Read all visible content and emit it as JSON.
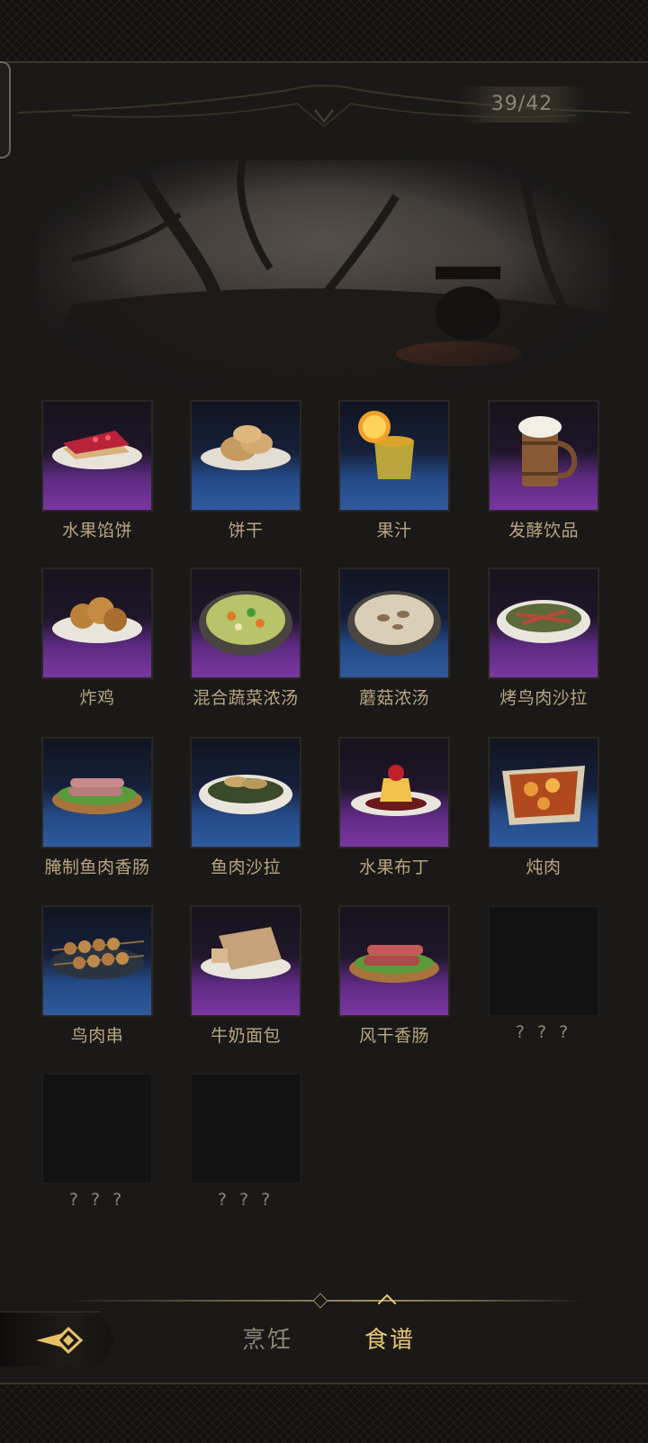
{
  "header": {
    "counter": "39/42"
  },
  "recipes": [
    {
      "label": "水果馅饼",
      "rarity": "purple",
      "icon": "fruit-pie-icon"
    },
    {
      "label": "饼干",
      "rarity": "blue",
      "icon": "biscuits-icon"
    },
    {
      "label": "果汁",
      "rarity": "blue",
      "icon": "juice-icon"
    },
    {
      "label": "发酵饮品",
      "rarity": "purple",
      "icon": "ale-mug-icon"
    },
    {
      "label": "炸鸡",
      "rarity": "purple",
      "icon": "fried-chicken-icon"
    },
    {
      "label": "混合蔬菜浓汤",
      "rarity": "purple",
      "icon": "vegetable-soup-icon"
    },
    {
      "label": "蘑菇浓汤",
      "rarity": "blue",
      "icon": "mushroom-soup-icon"
    },
    {
      "label": "烤鸟肉沙拉",
      "rarity": "purple",
      "icon": "bird-salad-icon"
    },
    {
      "label": "腌制鱼肉香肠",
      "rarity": "blue",
      "icon": "fish-sausage-icon"
    },
    {
      "label": "鱼肉沙拉",
      "rarity": "blue",
      "icon": "fish-salad-icon"
    },
    {
      "label": "水果布丁",
      "rarity": "purple",
      "icon": "pudding-icon"
    },
    {
      "label": "炖肉",
      "rarity": "blue",
      "icon": "stew-icon"
    },
    {
      "label": "鸟肉串",
      "rarity": "blue",
      "icon": "bird-skewer-icon"
    },
    {
      "label": "牛奶面包",
      "rarity": "purple",
      "icon": "milk-bread-icon"
    },
    {
      "label": "风干香肠",
      "rarity": "purple",
      "icon": "dried-sausage-icon"
    },
    {
      "label": "? ? ?",
      "rarity": "locked",
      "icon": "locked-slot"
    },
    {
      "label": "? ? ?",
      "rarity": "locked",
      "icon": "locked-slot"
    },
    {
      "label": "? ? ?",
      "rarity": "locked",
      "icon": "locked-slot"
    }
  ],
  "tabs": [
    {
      "label": "烹饪",
      "active": false
    },
    {
      "label": "食谱",
      "active": true
    }
  ],
  "colors": {
    "purple": "#7a37a2",
    "blue": "#2e5a9e",
    "label": "#b8a57f",
    "active_tab": "#e8c875",
    "inactive_tab": "#8d8576"
  }
}
